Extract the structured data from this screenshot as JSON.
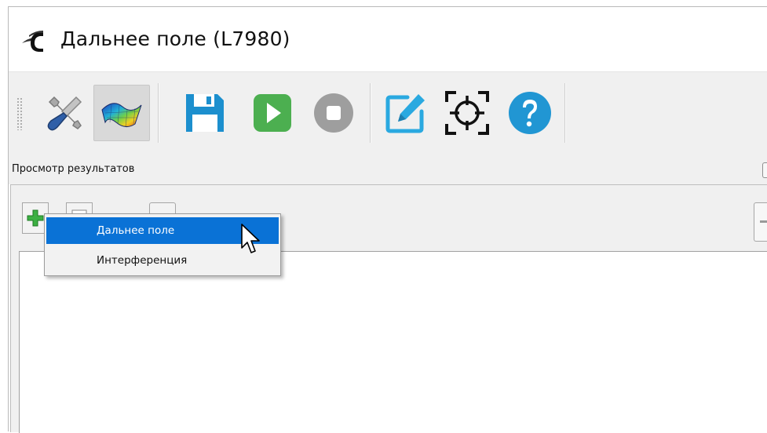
{
  "window": {
    "title": "Дальнее поле (L7980)",
    "app_icon": "app-logo-icon"
  },
  "toolbar": {
    "buttons": [
      {
        "name": "settings-tools-button",
        "icon": "wrench-screwdriver-icon",
        "pressed": false
      },
      {
        "name": "surface-plot-button",
        "icon": "surface-plot-icon",
        "pressed": true
      },
      {
        "name": "save-button",
        "icon": "floppy-disk-icon",
        "pressed": false
      },
      {
        "name": "run-button",
        "icon": "play-icon",
        "pressed": false
      },
      {
        "name": "stop-button",
        "icon": "stop-icon",
        "pressed": false
      },
      {
        "name": "edit-button",
        "icon": "edit-pencil-icon",
        "pressed": false
      },
      {
        "name": "target-button",
        "icon": "crosshair-icon",
        "pressed": false
      },
      {
        "name": "help-button",
        "icon": "help-question-icon",
        "pressed": false
      }
    ]
  },
  "panel": {
    "title": "Просмотр результатов"
  },
  "subtoolbar": {
    "buttons": [
      {
        "name": "add-button",
        "icon": "plus-icon"
      },
      {
        "name": "list-button",
        "icon": "list-icon"
      },
      {
        "name": "view-button",
        "icon": "eye-icon"
      }
    ]
  },
  "context_menu": {
    "items": [
      {
        "label": "Дальнее поле",
        "highlighted": true
      },
      {
        "label": "Интерференция",
        "highlighted": false
      }
    ]
  },
  "colors": {
    "accent": "#0a72d6",
    "save": "#1c8fce",
    "run": "#4caf50",
    "stop": "#9e9e9e",
    "help": "#2196d3"
  }
}
